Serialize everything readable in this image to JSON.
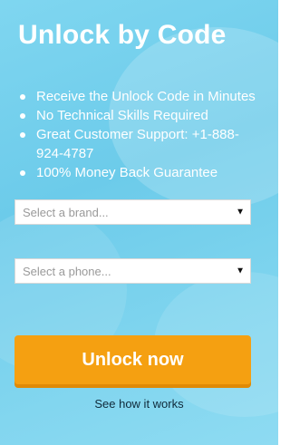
{
  "title": "Unlock by Code",
  "bullets": [
    "Receive the Unlock Code in Minutes",
    "No Technical Skills Required",
    "Great Customer Support: +1-888-924-4787",
    "100% Money Back Guarantee"
  ],
  "brand_select": {
    "placeholder": "Select a brand..."
  },
  "phone_select": {
    "placeholder": "Select a phone..."
  },
  "cta": {
    "label": "Unlock now"
  },
  "how_link": {
    "label": "See how it works"
  },
  "colors": {
    "panel_bg": "#6ccbea",
    "cta_bg": "#f5a011",
    "text": "#ffffff"
  }
}
